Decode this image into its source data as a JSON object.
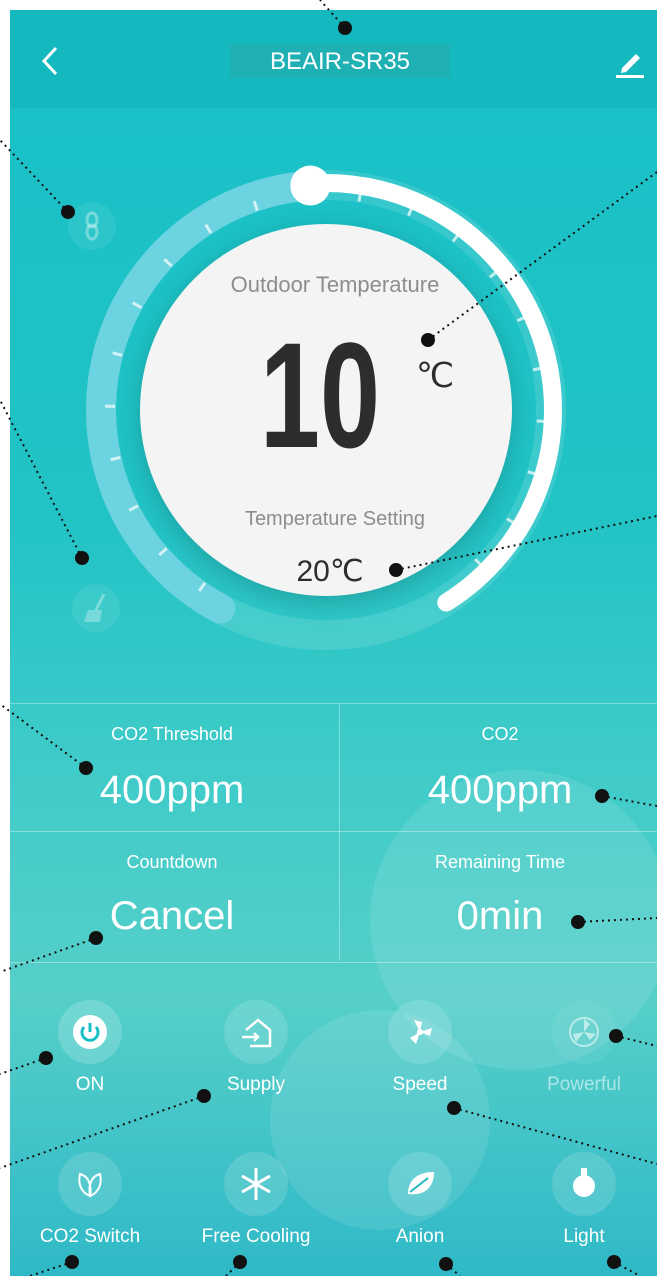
{
  "header": {
    "title": "BEAIR-SR35"
  },
  "dial": {
    "outdoor_label": "Outdoor Temperature",
    "outdoor_value": "10",
    "unit": "℃",
    "setting_label": "Temperature Setting",
    "setting_value": "20℃"
  },
  "stats": [
    {
      "label": "CO2 Threshold",
      "value": "400ppm"
    },
    {
      "label": "CO2",
      "value": "400ppm"
    },
    {
      "label": "Countdown",
      "value": "Cancel"
    },
    {
      "label": "Remaining Time",
      "value": "0min"
    }
  ],
  "controls_row1": [
    {
      "label": "ON",
      "icon": "power-icon"
    },
    {
      "label": "Supply",
      "icon": "supply-icon"
    },
    {
      "label": "Speed",
      "icon": "fan-speed-icon"
    },
    {
      "label": "Powerful",
      "icon": "powerful-fan-icon"
    }
  ],
  "controls_row2": [
    {
      "label": "CO2 Switch",
      "icon": "leaf-pair-icon"
    },
    {
      "label": "Free Cooling",
      "icon": "snowflake-icon"
    },
    {
      "label": "Anion",
      "icon": "leaf-icon"
    },
    {
      "label": "Light",
      "icon": "bulb-icon"
    }
  ],
  "side_icons": [
    "link-icon",
    "broom-icon"
  ],
  "colors": {
    "teal": "#17c0c6",
    "white": "#ffffff",
    "dial": "#f4f4f4",
    "text_dark": "#2d2d2d"
  }
}
